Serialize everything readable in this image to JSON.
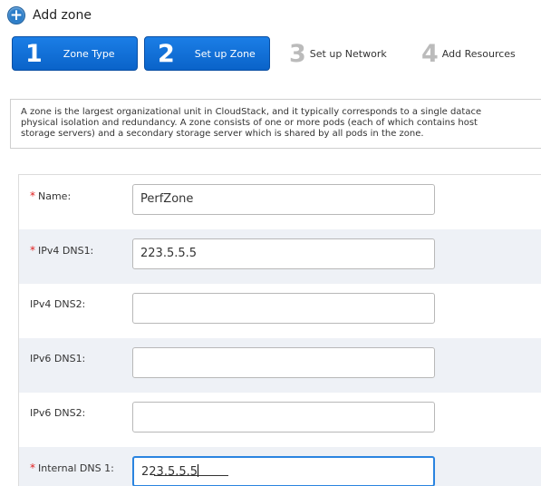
{
  "header": {
    "title": "Add zone",
    "icon": "add-zone-plus-icon",
    "accent": "#2d7ec9"
  },
  "steps": [
    {
      "number": "1",
      "label": "Zone Type",
      "active": true
    },
    {
      "number": "2",
      "label": "Set up Zone",
      "active": true
    },
    {
      "number": "3",
      "label": "Set up Network",
      "active": false
    },
    {
      "number": "4",
      "label": "Add Resources",
      "active": false
    }
  ],
  "info": {
    "lines": [
      "A zone is the largest organizational unit in CloudStack, and it typically corresponds to a single datace",
      "physical isolation and redundancy. A zone consists of one or more pods (each of which contains host",
      "storage servers) and a secondary storage server which is shared by all pods in the zone."
    ]
  },
  "form": {
    "fields": [
      {
        "label": "Name:",
        "required": true,
        "value": "PerfZone"
      },
      {
        "label": "IPv4 DNS1:",
        "required": true,
        "value": "223.5.5.5"
      },
      {
        "label": "IPv4 DNS2:",
        "required": false,
        "value": ""
      },
      {
        "label": "IPv6 DNS1:",
        "required": false,
        "value": ""
      },
      {
        "label": "IPv6 DNS2:",
        "required": false,
        "value": ""
      },
      {
        "label": "Internal DNS 1:",
        "required": true,
        "value": "223.5.5.5"
      }
    ]
  },
  "colors": {
    "step_active": "#0a63c9",
    "required": "#e02020",
    "focus": "#2a84e0",
    "row_alt": "#eef1f6"
  }
}
